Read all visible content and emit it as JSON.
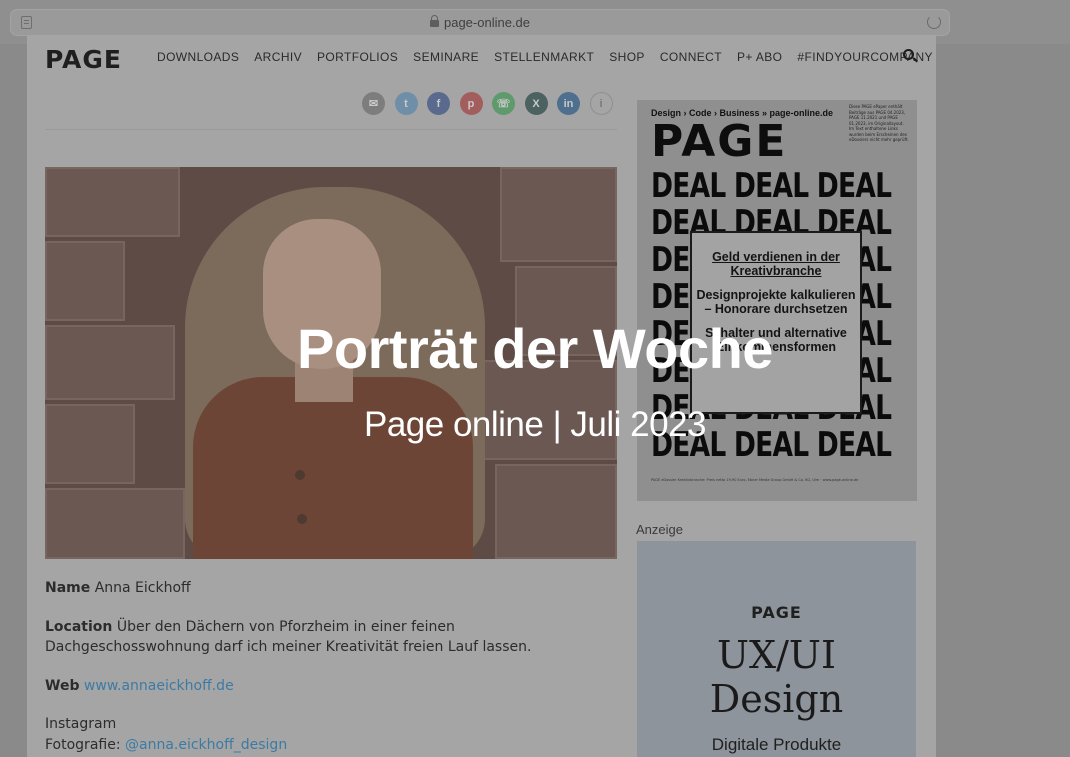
{
  "browser": {
    "url": "page-online.de"
  },
  "nav": {
    "logo": "PAGE",
    "items": [
      "DOWNLOADS",
      "ARCHIV",
      "PORTFOLIOS",
      "SEMINARE",
      "STELLENMARKT",
      "SHOP",
      "CONNECT",
      "P+ ABO",
      "#FINDYOURCOMPANY"
    ]
  },
  "share": {
    "icons": [
      {
        "name": "email-icon",
        "glyph": "✉",
        "color": "#7d7d7d"
      },
      {
        "name": "twitter-icon",
        "glyph": "t",
        "color": "#6f8fa8"
      },
      {
        "name": "facebook-icon",
        "glyph": "f",
        "color": "#5a6a8e"
      },
      {
        "name": "pinterest-icon",
        "glyph": "p",
        "color": "#a35d5d"
      },
      {
        "name": "whatsapp-icon",
        "glyph": "☏",
        "color": "#5f9a6c"
      },
      {
        "name": "xing-icon",
        "glyph": "X",
        "color": "#4b6260"
      },
      {
        "name": "linkedin-icon",
        "glyph": "in",
        "color": "#4f6f8e"
      },
      {
        "name": "info-icon",
        "glyph": "i",
        "color": "#ababab"
      }
    ]
  },
  "article": {
    "name_label": "Name",
    "name_value": "Anna Eickhoff",
    "location_label": "Location",
    "location_value": "Über den Dächern von Pforzheim in einer feinen Dachgeschosswohnung darf ich meiner Kreativität freien Lauf lassen.",
    "web_label": "Web",
    "web_value": "www.annaeickhoff.de",
    "instagram_label": "Instagram",
    "fotografie_label": "Fotografie:",
    "instagram_value": "@anna.eickhoff_design"
  },
  "magazine": {
    "top_line": "Design › Code › Business   »   page-online.de",
    "logo": "PAGE",
    "small_text": "Diese PAGE ePaper enthält Beiträge aus PAGE 04.2023, PAGE 11.2021 und PAGE 01.2023, im Originallayout. Im Text enthaltene Links wurden beim Erscheinen des eDossiers nicht mehr geprüft.",
    "deal_lines": [
      "DEAL DEAL DEAL",
      "DEAL DEAL DEAL",
      "DEAL DEAL DEAL",
      "DEAL DEAL DEAL",
      "DEAL DEAL DEAL",
      "DEAL DEAL DEAL",
      "DEAL DEAL DEAL",
      "DEAL DEAL DEAL"
    ],
    "box_line1": "Geld verdienen in der Kreativbranche",
    "box_line2": "Designprojekte kalkulieren – Honorare durchsetzen",
    "box_line3": "Schalter und alternative Einkommensformen",
    "footer": "PAGE eDossier Kreativbranche: Preis netto 19,90 Euro, Ebner Media Group GmbH & Co. KG, Ulm · www.page-online.de"
  },
  "ad": {
    "label": "Anzeige",
    "logo": "PAGE",
    "title_line1": "UX/UI",
    "title_line2": "Design",
    "subtitle": "Digitale Produkte"
  },
  "overlay": {
    "title": "Porträt der Woche",
    "subtitle": "Page online | Juli 2023"
  }
}
